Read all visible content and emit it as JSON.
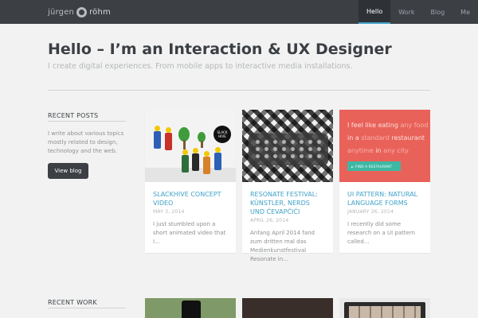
{
  "header": {
    "logo_first": "jürgen",
    "logo_second": "röhm",
    "nav": [
      {
        "label": "Hello",
        "active": true
      },
      {
        "label": "Work",
        "active": false
      },
      {
        "label": "Blog",
        "active": false
      },
      {
        "label": "Me",
        "active": false
      }
    ]
  },
  "hero": {
    "title": "Hello – I’m an Interaction & UX Designer",
    "subtitle": "I create digital experiences. From mobile apps to interactive media installations."
  },
  "recent_posts": {
    "heading": "RECENT POSTS",
    "description": "I write about various topics mostly related to design, technology and the web.",
    "button": "View blog"
  },
  "posts": [
    {
      "title": "SLACKHIVE CONCEPT VIDEO",
      "date": "MAY 3, 2014",
      "excerpt": "I just stumbled upon a short animated video that I…",
      "thumb_sign": "SLACK HIVE"
    },
    {
      "title": "RESONATE FESTIVAL: KÜNSTLER, NERDS UND ĆEVAPČIĆI",
      "date": "APRIL 26, 2014",
      "excerpt": "Anfang April 2014 fand zum dritten mal das Medienkunstfestival Resonate in…"
    },
    {
      "title": "UI PATTERN: NATURAL LANGUAGE FORMS",
      "date": "JANUARY 26, 2014",
      "excerpt": "I recently did some research on a UI pattern called…",
      "thumb_line1_a": "I feel like eating ",
      "thumb_line1_b": "any food",
      "thumb_line2_a": "in a ",
      "thumb_line2_b": "standard",
      "thumb_line2_c": " restaurant",
      "thumb_line3_a": "anytime",
      "thumb_line3_b": " in ",
      "thumb_line3_c": "any city",
      "thumb_button": "► FIND A RESTAURANT"
    }
  ],
  "recent_work": {
    "heading": "RECENT WORK"
  },
  "colors": {
    "accent": "#3fa1c7",
    "topbar": "#3c3f44",
    "pattern_red": "#e9625a",
    "pattern_green": "#3cb8a3"
  }
}
